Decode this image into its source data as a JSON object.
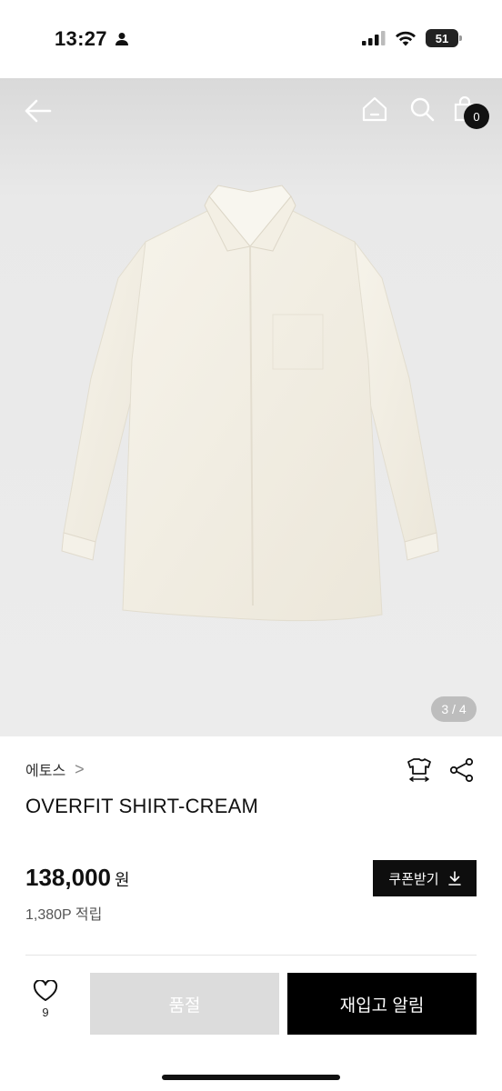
{
  "status_bar": {
    "time": "13:27",
    "battery": "51"
  },
  "header": {
    "cart_count": "0"
  },
  "gallery": {
    "page_indicator": "3 / 4"
  },
  "product": {
    "brand": "에토스",
    "brand_chevron": ">",
    "name": "OVERFIT SHIRT-CREAM",
    "price": "138,000",
    "currency": "원",
    "points": "1,380P 적립"
  },
  "coupon_button": {
    "label": "쿠폰받기"
  },
  "bottom_bar": {
    "like_count": "9",
    "soldout_label": "품절",
    "restock_label": "재입고 알림"
  },
  "colors": {
    "primary": "#000000",
    "disabled": "#dcdcdc",
    "image_bg": "#ececec",
    "shirt": "#f3efe4"
  }
}
